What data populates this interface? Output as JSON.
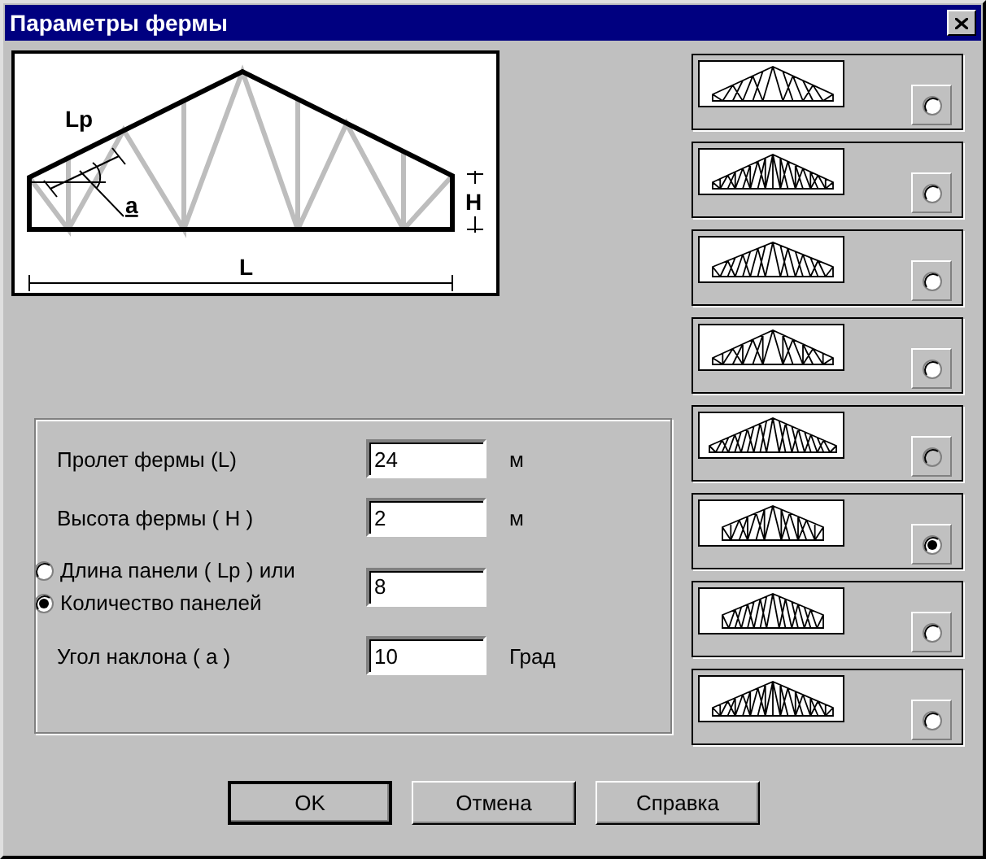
{
  "window": {
    "title": "Параметры фермы"
  },
  "diagram": {
    "labels": [
      "Lp",
      "a",
      "H",
      "L"
    ]
  },
  "fields": [
    {
      "kind": "input",
      "label": "Пролет фермы (L)",
      "value": "24",
      "unit": "м"
    },
    {
      "kind": "input",
      "label": "Высота фермы ( H )",
      "value": "2",
      "unit": "м"
    },
    {
      "kind": "choice",
      "options": [
        {
          "label": "Длина панели ( Lp ) или",
          "selected": false
        },
        {
          "label": "Количество панелей",
          "selected": true
        }
      ],
      "value": "8"
    },
    {
      "kind": "input",
      "label": "Угол наклона ( a )",
      "value": "10",
      "unit": "Град"
    }
  ],
  "truss_types": [
    {
      "selected": false,
      "disabled": false
    },
    {
      "selected": false,
      "disabled": false
    },
    {
      "selected": false,
      "disabled": false
    },
    {
      "selected": false,
      "disabled": false
    },
    {
      "selected": false,
      "disabled": true
    },
    {
      "selected": true,
      "disabled": false
    },
    {
      "selected": false,
      "disabled": false
    },
    {
      "selected": false,
      "disabled": false
    }
  ],
  "buttons": [
    {
      "label": "OK",
      "default": true
    },
    {
      "label": "Отмена",
      "default": false
    },
    {
      "label": "Справка",
      "default": false
    }
  ]
}
